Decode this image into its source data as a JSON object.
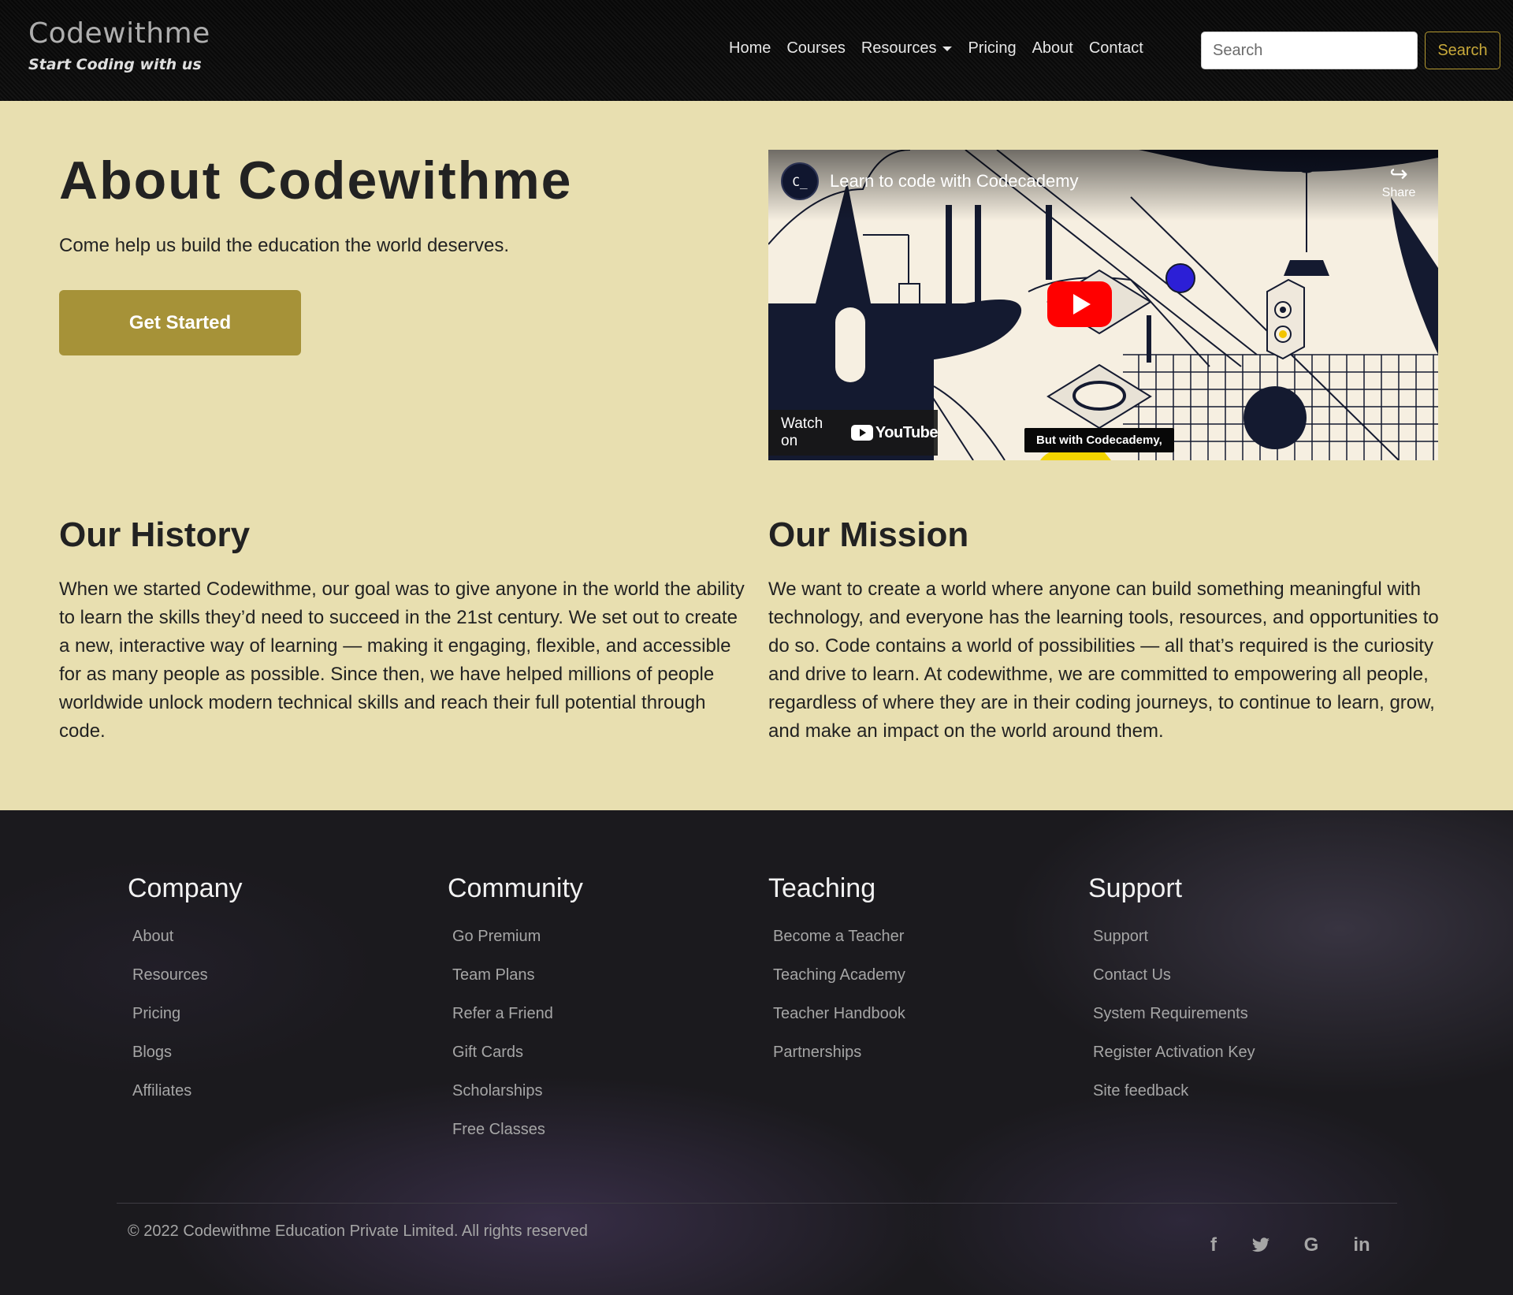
{
  "navbar": {
    "brand_name": "Codewithme",
    "brand_tagline": "Start Coding with us",
    "links": [
      {
        "label": "Home"
      },
      {
        "label": "Courses"
      },
      {
        "label": "Resources",
        "dropdown": true
      },
      {
        "label": "Pricing"
      },
      {
        "label": "About"
      },
      {
        "label": "Contact"
      }
    ],
    "search_placeholder": "Search",
    "search_button": "Search"
  },
  "hero": {
    "title": "About Codewithme",
    "subtitle": "Come help us build the education the world deserves.",
    "cta_label": "Get Started"
  },
  "video": {
    "channel_initials": "C_",
    "title": "Learn to code with Codecademy",
    "share_label": "Share",
    "watch_on_label": "Watch on",
    "youtube_label": "YouTube",
    "caption": "But with Codecademy,"
  },
  "history": {
    "title": "Our History",
    "body": "When we started Codewithme, our goal was to give anyone in the world the ability to learn the skills they’d need to succeed in the 21st century. We set out to create a new, interactive way of learning — making it engaging, flexible, and accessible for as many people as possible. Since then, we have helped millions of people worldwide unlock modern technical skills and reach their full potential through code."
  },
  "mission": {
    "title": "Our Mission",
    "body": "We want to create a world where anyone can build something meaningful with technology, and everyone has the learning tools, resources, and opportunities to do so. Code contains a world of possibilities — all that’s required is the curiosity and drive to learn. At codewithme, we are committed to empowering all people, regardless of where they are in their coding journeys, to continue to learn, grow, and make an impact on the world around them."
  },
  "footer": {
    "columns": [
      {
        "title": "Company",
        "links": [
          "About",
          "Resources",
          "Pricing",
          "Blogs",
          "Affiliates"
        ]
      },
      {
        "title": "Community",
        "links": [
          "Go Premium",
          "Team Plans",
          "Refer a Friend",
          "Gift Cards",
          "Scholarships",
          "Free Classes"
        ]
      },
      {
        "title": "Teaching",
        "links": [
          "Become a Teacher",
          "Teaching Academy",
          "Teacher Handbook",
          "Partnerships"
        ]
      },
      {
        "title": "Support",
        "links": [
          "Support",
          "Contact Us",
          "System Requirements",
          "Register Activation Key",
          "Site feedback"
        ]
      }
    ],
    "copyright": "© 2022 Codewithme Education Private Limited. All rights reserved",
    "social": [
      {
        "icon": "facebook-icon",
        "glyph": "f"
      },
      {
        "icon": "twitter-icon",
        "glyph": "🐦"
      },
      {
        "icon": "google-icon",
        "glyph": "G"
      },
      {
        "icon": "linkedin-icon",
        "glyph": "in"
      }
    ]
  },
  "colors": {
    "accent": "#a69238",
    "page_bg": "#e8dfb0",
    "footer_bg": "#1b1a1e",
    "nav_bg": "#0b0b0b"
  }
}
